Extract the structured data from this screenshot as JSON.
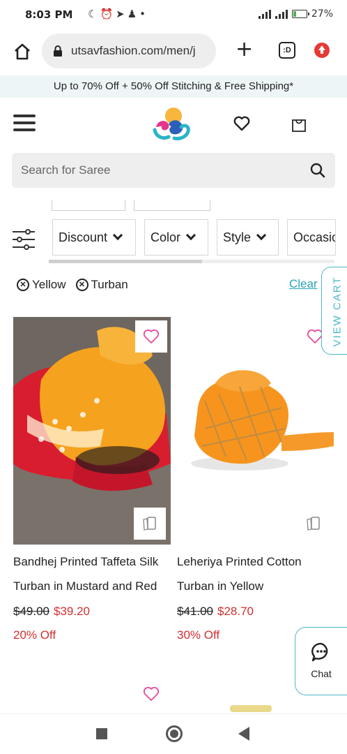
{
  "status_bar": {
    "time": "8:03 PM",
    "notification_icons": [
      "moon-icon",
      "alarm-icon",
      "telegram-icon",
      "snapchat-icon",
      "dot-icon"
    ],
    "battery_percent": "27%",
    "battery_level": 0.27,
    "battery_color": "#4caf50"
  },
  "browser": {
    "url": "utsavfashion.com/men/j",
    "tab_count": ":D",
    "update_color": "#e53935"
  },
  "promo": {
    "text": "Up to 70% Off + 50% Off Stitching & Free Shipping*"
  },
  "search": {
    "placeholder": "Search for Saree"
  },
  "filters": {
    "chips": [
      "Discount",
      "Color",
      "Style",
      "Occasio"
    ],
    "applied": [
      "Yellow",
      "Turban"
    ],
    "clear_label": "Clear"
  },
  "view_cart_label": "VIEW CART",
  "products": [
    {
      "name_line1": "Bandhej Printed Taffeta Silk",
      "name_line2": "Turban in Mustard and Red",
      "old_price": "$49.00",
      "new_price": "$39.20",
      "discount": "20% Off"
    },
    {
      "name_line1": "Leheriya Printed Cotton",
      "name_line2": "Turban in Yellow",
      "old_price": "$41.00",
      "new_price": "$28.70",
      "discount": "30% Off"
    }
  ],
  "chat": {
    "label": "Chat"
  },
  "colors": {
    "accent": "#4bb7c8",
    "sale": "#d32f2f",
    "wish": "#e84a9a"
  }
}
